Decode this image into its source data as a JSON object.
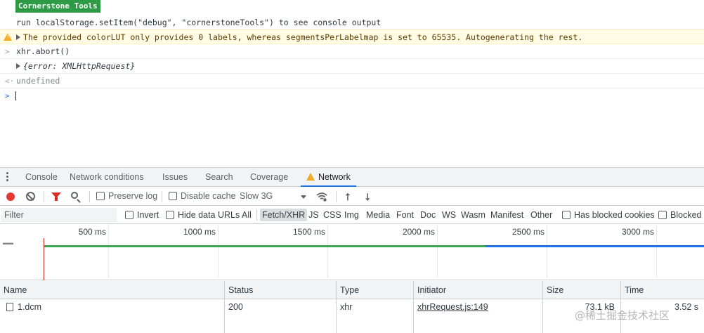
{
  "console": {
    "badge": "Cornerstone Tools",
    "debug_hint": "run localStorage.setItem(\"debug\", \"cornerstoneTools\") to see console output",
    "warning": "The provided colorLUT only provides 0 labels, whereas segmentsPerLabelmap is set to 65535. Autogenerating the rest.",
    "input_prompt": ">",
    "command": "xhr.abort()",
    "result_object": "{error: XMLHttpRequest}",
    "return_prompt": "<·",
    "return_value": "undefined",
    "active_prompt": ">"
  },
  "drawer_tabs": {
    "items": [
      {
        "label": "Console"
      },
      {
        "label": "Network conditions"
      },
      {
        "label": "Issues"
      },
      {
        "label": "Search"
      },
      {
        "label": "Coverage"
      },
      {
        "label": "Network",
        "active": true,
        "has_warning": true
      }
    ]
  },
  "toolbar": {
    "preserve_log": "Preserve log",
    "disable_cache": "Disable cache",
    "throttling": "Slow 3G"
  },
  "filterbar": {
    "placeholder": "Filter",
    "invert": "Invert",
    "hide_data_urls": "Hide data URLs",
    "types": [
      "All",
      "Fetch/XHR",
      "JS",
      "CSS",
      "Img",
      "Media",
      "Font",
      "Doc",
      "WS",
      "Wasm",
      "Manifest",
      "Other"
    ],
    "selected_type": "Fetch/XHR",
    "has_blocked_cookies": "Has blocked cookies",
    "blocked_requests": "Blocked R"
  },
  "overview": {
    "ticks": [
      "500 ms",
      "1000 ms",
      "1500 ms",
      "2000 ms",
      "2500 ms",
      "3000 ms"
    ]
  },
  "table": {
    "columns": [
      "Name",
      "Status",
      "Type",
      "Initiator",
      "Size",
      "Time"
    ],
    "rows": [
      {
        "name": "1.dcm",
        "status": "200",
        "type": "xhr",
        "initiator": "xhrRequest.js:149",
        "size": "73.1 kB",
        "time": "3.52 s"
      }
    ]
  },
  "watermark": "@稀土掘金技术社区",
  "colors": {
    "badge_bg": "#2e9a45",
    "warning_bg": "#fffbe5",
    "record": "#e53935",
    "active_tab": "#1a73e8",
    "timeline_green": "#34a853",
    "timeline_blue": "#1a73e8"
  }
}
